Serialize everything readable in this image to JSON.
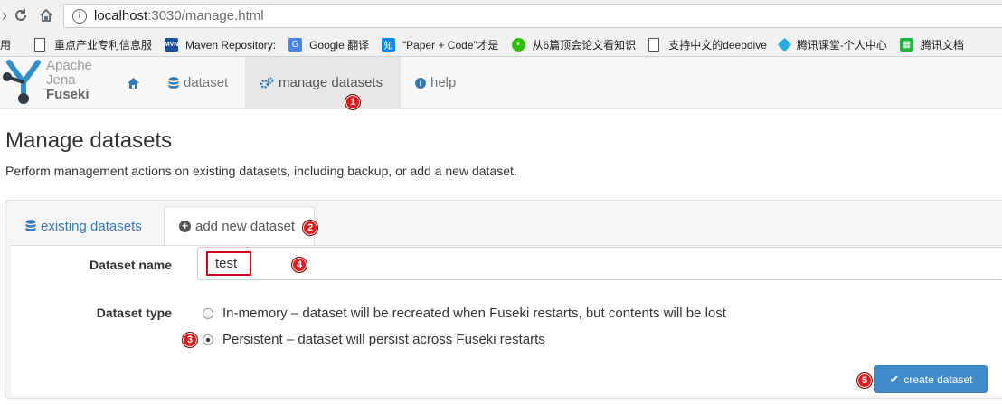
{
  "browser": {
    "url_host": "localhost",
    "url_path": ":3030/manage.html",
    "bookmarks": [
      {
        "label": "用",
        "icon": "none"
      },
      {
        "label": "重点产业专利信息服",
        "icon": "page-icon"
      },
      {
        "label": "Maven Repository:",
        "icon": "mvn-icon"
      },
      {
        "label": "Google 翻译",
        "icon": "translate-icon"
      },
      {
        "label": "“Paper + Code”才是",
        "icon": "zhihu-icon"
      },
      {
        "label": "从6篇顶会论文看知识",
        "icon": "wechat-icon"
      },
      {
        "label": "支持中文的deepdive",
        "icon": "page-icon"
      },
      {
        "label": "腾讯课堂-个人中心",
        "icon": "ketang-icon"
      },
      {
        "label": "腾讯文档",
        "icon": "docs-icon"
      }
    ]
  },
  "navbar": {
    "brand_line1": "Apache",
    "brand_line2": "Jena",
    "brand_line3": "Fuseki",
    "items": [
      {
        "label": "",
        "icon": "home-icon"
      },
      {
        "label": "dataset",
        "icon": "database-icon"
      },
      {
        "label": "manage datasets",
        "icon": "cogs-icon"
      },
      {
        "label": "help",
        "icon": "info-icon"
      }
    ]
  },
  "page": {
    "title": "Manage datasets",
    "description": "Perform management actions on existing datasets, including backup, or add a new dataset."
  },
  "tabs": {
    "existing": "existing datasets",
    "add_new": "add new dataset"
  },
  "form": {
    "name_label": "Dataset name",
    "name_value": "test",
    "type_label": "Dataset type",
    "options": [
      {
        "label": "In-memory – dataset will be recreated when Fuseki restarts, but contents will be lost",
        "checked": false
      },
      {
        "label": "Persistent – dataset will persist across Fuseki restarts",
        "checked": true
      }
    ],
    "submit_label": "create dataset"
  },
  "annotations": [
    "1",
    "2",
    "3",
    "4",
    "5"
  ],
  "colors": {
    "accent": "#428bca",
    "link": "#337ab7",
    "marker": "#e11b1b",
    "highlight_box": "#d0021b"
  }
}
